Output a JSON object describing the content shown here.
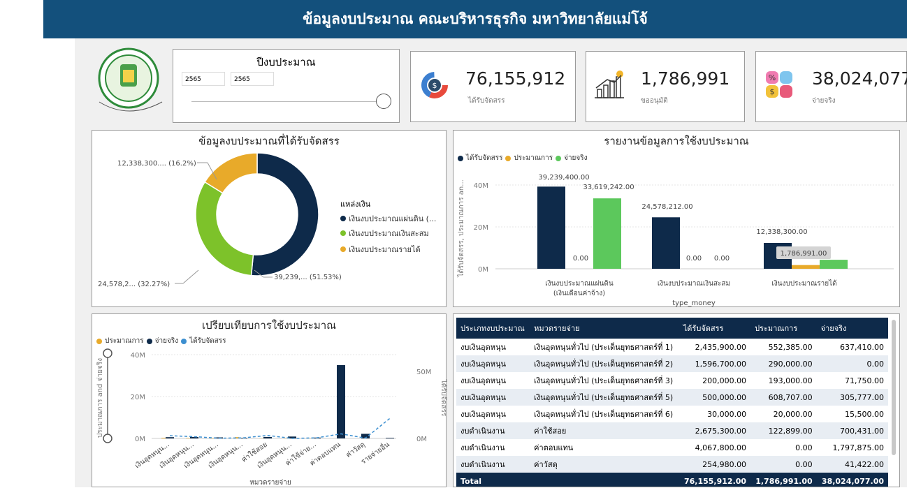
{
  "header": {
    "title": "ข้อมูลงบประมาณ คณะบริหารธุรกิจ มหาวิทยาลัยแม่โจ้"
  },
  "colors": {
    "navy": "#13507c",
    "dark": "#0e2a4a",
    "green": "#5cc85c",
    "gold": "#e8aa2a",
    "lime": "#7dc22a",
    "blue": "#3c8fd0"
  },
  "year_slicer": {
    "title": "ปีงบประมาณ",
    "from": "2565",
    "to": "2565"
  },
  "kpis": [
    {
      "value": "76,155,912",
      "label": "ได้รับจัดสรร",
      "icon": "donut-coin-icon"
    },
    {
      "value": "1,786,991",
      "label": "ขออนุมัติ",
      "icon": "bar-growth-icon"
    },
    {
      "value": "38,024,077",
      "label": "จ่ายจริง",
      "icon": "percent-quadrant-icon"
    }
  ],
  "donut": {
    "title": "ข้อมูลงบประมาณที่ได้รับจัดสรร",
    "legend_title": "แหล่งเงิน",
    "labels": [
      "12,338,300.... (16.2%)",
      "24,578,2... (32.27%)",
      "39,239,... (51.53%)"
    ],
    "legend": [
      "เงินงบประมาณแผ่นดิน (...",
      "เงินงบประมาณเงินสะสม",
      "เงินงบประมาณรายได้"
    ]
  },
  "bar_report": {
    "title": "รายงานข้อมูลการใช้งบประมาณ",
    "legend": [
      "ได้รับจัดสรร",
      "ประมาณการ",
      "จ่ายจริง"
    ],
    "ylabel": "ได้รับจัดสรร, ประมาณการ an...",
    "xlabel": "type_money",
    "yticks": [
      "40M",
      "20M",
      "0M"
    ],
    "cat_lines": [
      [
        "เงินงบประมาณแผ่นดิน",
        "(เงินเดือนค่าจ้าง)"
      ],
      [
        "เงินงบประมาณเงินสะสม"
      ],
      [
        "เงินงบประมาณรายได้"
      ]
    ],
    "value_labels": [
      "39,239,400.00",
      "0.00",
      "33,619,242.00",
      "24,578,212.00",
      "0.00",
      "0.00",
      "12,338,300.00",
      "1,786,991.00"
    ]
  },
  "chart_data": [
    {
      "type": "pie",
      "title": "ข้อมูลงบประมาณที่ได้รับจัดสรร",
      "categories": [
        "เงินงบประมาณแผ่นดิน (เงินเดือนค่าจ้าง)",
        "เงินงบประมาณเงินสะสม",
        "เงินงบประมาณรายได้"
      ],
      "values": [
        39239400,
        24578212,
        12338300
      ],
      "percent": [
        51.53,
        32.27,
        16.2
      ]
    },
    {
      "type": "bar",
      "title": "รายงานข้อมูลการใช้งบประมาณ",
      "categories": [
        "เงินงบประมาณแผ่นดิน (เงินเดือนค่าจ้าง)",
        "เงินงบประมาณเงินสะสม",
        "เงินงบประมาณรายได้"
      ],
      "series": [
        {
          "name": "ได้รับจัดสรร",
          "values": [
            39239400,
            24578212,
            12338300
          ]
        },
        {
          "name": "ประมาณการ",
          "values": [
            0,
            0,
            1786991
          ]
        },
        {
          "name": "จ่ายจริง",
          "values": [
            33619242,
            0,
            4300000
          ]
        }
      ],
      "ylim": [
        0,
        48000000
      ],
      "xlabel": "type_money"
    },
    {
      "type": "bar",
      "title": "เปรียบเทียบการใช้งบประมาณ",
      "categories": [
        "เงินอุดหนุน...",
        "เงินอุดหนุน...",
        "เงินอุดหนุน...",
        "เงินอุดหนุน...",
        "ค่าใช้สอย",
        "เงินอุดหนุน...",
        "ค่าใช้จ่าย...",
        "ค่าตอบแทน",
        "ค่าวัสดุ",
        "รายจ่ายอื่น"
      ],
      "series": [
        {
          "name": "ประมาณการ",
          "values": [
            0.3,
            0.2,
            0.2,
            0.6,
            0.1,
            0.1,
            0.1,
            0,
            0,
            0
          ]
        },
        {
          "name": "จ่ายจริง",
          "values": [
            0.6,
            0.7,
            0.5,
            0.3,
            0.7,
            0.9,
            0.4,
            35,
            2.2,
            0.3
          ]
        },
        {
          "name": "ได้รับจัดสรร",
          "values": [
            2.4,
            1.6,
            0.2,
            0.5,
            2.7,
            0.03,
            0.5,
            4.1,
            0.3,
            18
          ]
        }
      ],
      "ylim": [
        0,
        45
      ],
      "y2lim": [
        0,
        60
      ]
    }
  ],
  "compare": {
    "title": "เปรียบเทียบการใช้งบประมาณ",
    "legend": [
      "ประมาณการ",
      "จ่ายจริง",
      "ได้รับจัดสรร"
    ],
    "ylabel": "ประมาณการ and จ่ายจริง",
    "y2label": "ได้รับจัดสรร",
    "xlabel": "หมวดรายจ่าย",
    "yticks": [
      "40M",
      "20M",
      "0M"
    ],
    "y2ticks": [
      "50M",
      "0M"
    ]
  },
  "table": {
    "headers": [
      "ประเภทงบประมาณ",
      "หมวดรายจ่าย",
      "ได้รับจัดสรร",
      "ประมาณการ",
      "จ่ายจริง"
    ],
    "rows": [
      [
        "งบเงินอุดหนุน",
        "เงินอุดหนุนทั่วไป (ประเด็นยุทธศาสตร์ที่ 1)",
        "2,435,900.00",
        "552,385.00",
        "637,410.00"
      ],
      [
        "งบเงินอุดหนุน",
        "เงินอุดหนุนทั่วไป (ประเด็นยุทธศาสตร์ที่ 2)",
        "1,596,700.00",
        "290,000.00",
        "0.00"
      ],
      [
        "งบเงินอุดหนุน",
        "เงินอุดหนุนทั่วไป (ประเด็นยุทธศาสตร์ที่ 3)",
        "200,000.00",
        "193,000.00",
        "71,750.00"
      ],
      [
        "งบเงินอุดหนุน",
        "เงินอุดหนุนทั่วไป (ประเด็นยุทธศาสตร์ที่ 5)",
        "500,000.00",
        "608,707.00",
        "305,777.00"
      ],
      [
        "งบเงินอุดหนุน",
        "เงินอุดหนุนทั่วไป (ประเด็นยุทธศาสตร์ที่ 6)",
        "30,000.00",
        "20,000.00",
        "15,500.00"
      ],
      [
        "งบดำเนินงาน",
        "ค่าใช้สอย",
        "2,675,300.00",
        "122,899.00",
        "700,431.00"
      ],
      [
        "งบดำเนินงาน",
        "ค่าตอบแทน",
        "4,067,800.00",
        "0.00",
        "1,797,875.00"
      ],
      [
        "งบดำเนินงาน",
        "ค่าวัสดุ",
        "254,980.00",
        "0.00",
        "41,422.00"
      ]
    ],
    "total": [
      "Total",
      "",
      "76,155,912.00",
      "1,786,991.00",
      "38,024,077.00"
    ]
  }
}
